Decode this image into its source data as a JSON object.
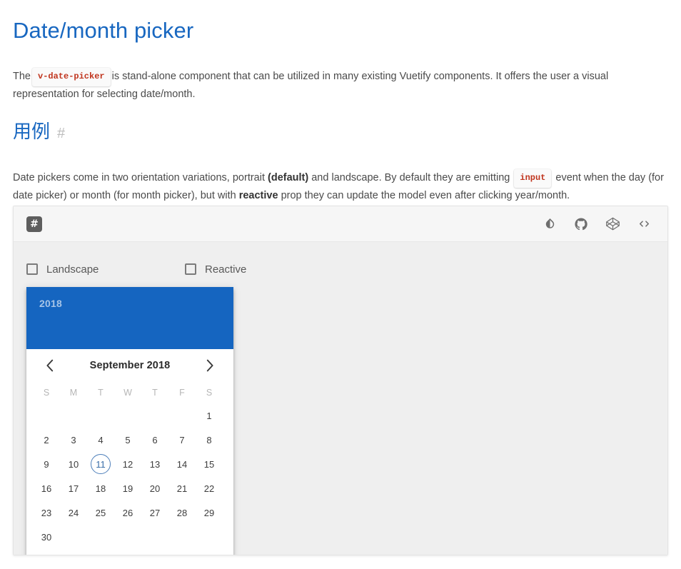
{
  "page": {
    "title": "Date/month picker",
    "intro": {
      "before": "The",
      "code": "v-date-picker",
      "after": "is stand-alone component that can be utilized in many existing Vuetify components. It offers the user a visual representation for selecting date/month."
    },
    "section": {
      "heading": "用例",
      "anchor": "#",
      "paragraph": {
        "p1": "Date pickers come in two orientation variations, portrait ",
        "b1": "(default)",
        "p2": " and landscape. By default they are emitting ",
        "code": "input",
        "p3": " event when the day (for date picker) or month (for month picker), but with ",
        "b2": "reactive",
        "p4": " prop they can update the model even after clicking year/month."
      }
    }
  },
  "example": {
    "toolbar": {
      "hash_badge": "#",
      "icons": [
        {
          "name": "invert-colors-icon",
          "title": "Toggle theme"
        },
        {
          "name": "github-icon",
          "title": "View on GitHub"
        },
        {
          "name": "codepen-icon",
          "title": "Edit on Codepen"
        },
        {
          "name": "code-icon",
          "title": "View source"
        }
      ]
    },
    "controls": {
      "landscape": {
        "label": "Landscape",
        "checked": false
      },
      "reactive": {
        "label": "Reactive",
        "checked": false
      }
    },
    "picker": {
      "header": {
        "year": "2018",
        "date": ""
      },
      "nav": {
        "prev": "‹",
        "title": "September 2018",
        "next": "›"
      },
      "weekdays": [
        "S",
        "M",
        "T",
        "W",
        "T",
        "F",
        "S"
      ],
      "weeks": [
        [
          "",
          "",
          "",
          "",
          "",
          "",
          "1"
        ],
        [
          "2",
          "3",
          "4",
          "5",
          "6",
          "7",
          "8"
        ],
        [
          "9",
          "10",
          "11",
          "12",
          "13",
          "14",
          "15"
        ],
        [
          "16",
          "17",
          "18",
          "19",
          "20",
          "21",
          "22"
        ],
        [
          "23",
          "24",
          "25",
          "26",
          "27",
          "28",
          "29"
        ],
        [
          "30",
          "",
          "",
          "",
          "",
          "",
          ""
        ]
      ],
      "current_day": "11"
    }
  },
  "colors": {
    "accent": "#1867c0",
    "picker_header": "#1565c0",
    "code_red": "#c0341d",
    "current_day_ring": "#4d7fba"
  }
}
